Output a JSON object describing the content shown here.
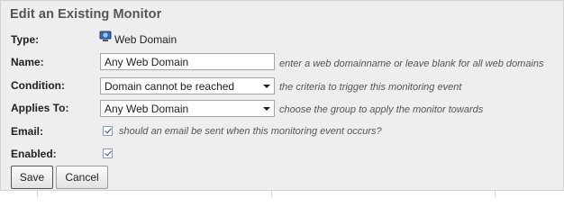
{
  "form": {
    "title": "Edit an Existing Monitor",
    "type": {
      "label": "Type:",
      "value": "Web Domain",
      "icon": "web-domain-icon"
    },
    "name": {
      "label": "Name:",
      "value": "Any Web Domain",
      "hint": "enter a web domainname or leave blank for all web domains"
    },
    "condition": {
      "label": "Condition:",
      "selected": "Domain cannot be reached",
      "hint": "the criteria to trigger this monitoring event"
    },
    "applies_to": {
      "label": "Applies To:",
      "selected": "Any Web Domain",
      "hint": "choose the group to apply the monitor towards"
    },
    "email": {
      "label": "Email:",
      "checked": true,
      "hint": "should an email be sent when this monitoring event occurs?"
    },
    "enabled": {
      "label": "Enabled:",
      "checked": true
    },
    "buttons": {
      "save": "Save",
      "cancel": "Cancel"
    }
  }
}
